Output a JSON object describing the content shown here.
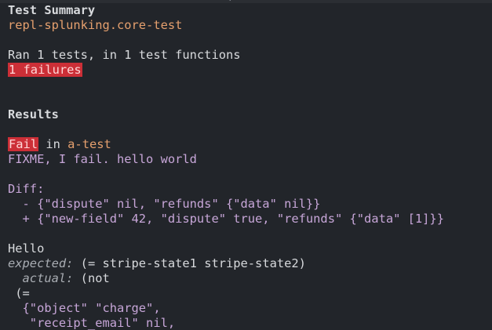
{
  "window": {
    "title_fragment": ", "
  },
  "summary": {
    "heading": "Test Summary",
    "namespace": "repl-splunking.core-test",
    "ran_line": "Ran 1 tests, in 1 test functions",
    "failures_badge": "1 failures"
  },
  "results": {
    "heading": "Results",
    "fail_label": "Fail",
    "in_word": " in ",
    "test_name": "a-test",
    "message": "FIXME, I fail. hello world",
    "diff_label": "Diff:",
    "diff_minus": "  - {\"dispute\" nil, \"refunds\" {\"data\" nil}}",
    "diff_plus": "  + {\"new-field\" 42, \"dispute\" true, \"refunds\" {\"data\" [1]}}",
    "hello": "Hello",
    "expected_label": "expected:",
    "expected_value": " (= stripe-state1 stripe-state2)",
    "actual_label": "  actual:",
    "actual_value": " (not",
    "actual_line2": " (=",
    "actual_line3": "  {\"object\" \"charge\",",
    "actual_line4": "   \"receipt_email\" nil,"
  },
  "colors": {
    "background": "#22252a",
    "text": "#d8dadd",
    "orange": "#e5a06e",
    "purple": "#c7a6d8",
    "fail_red": "#cc2f37"
  }
}
